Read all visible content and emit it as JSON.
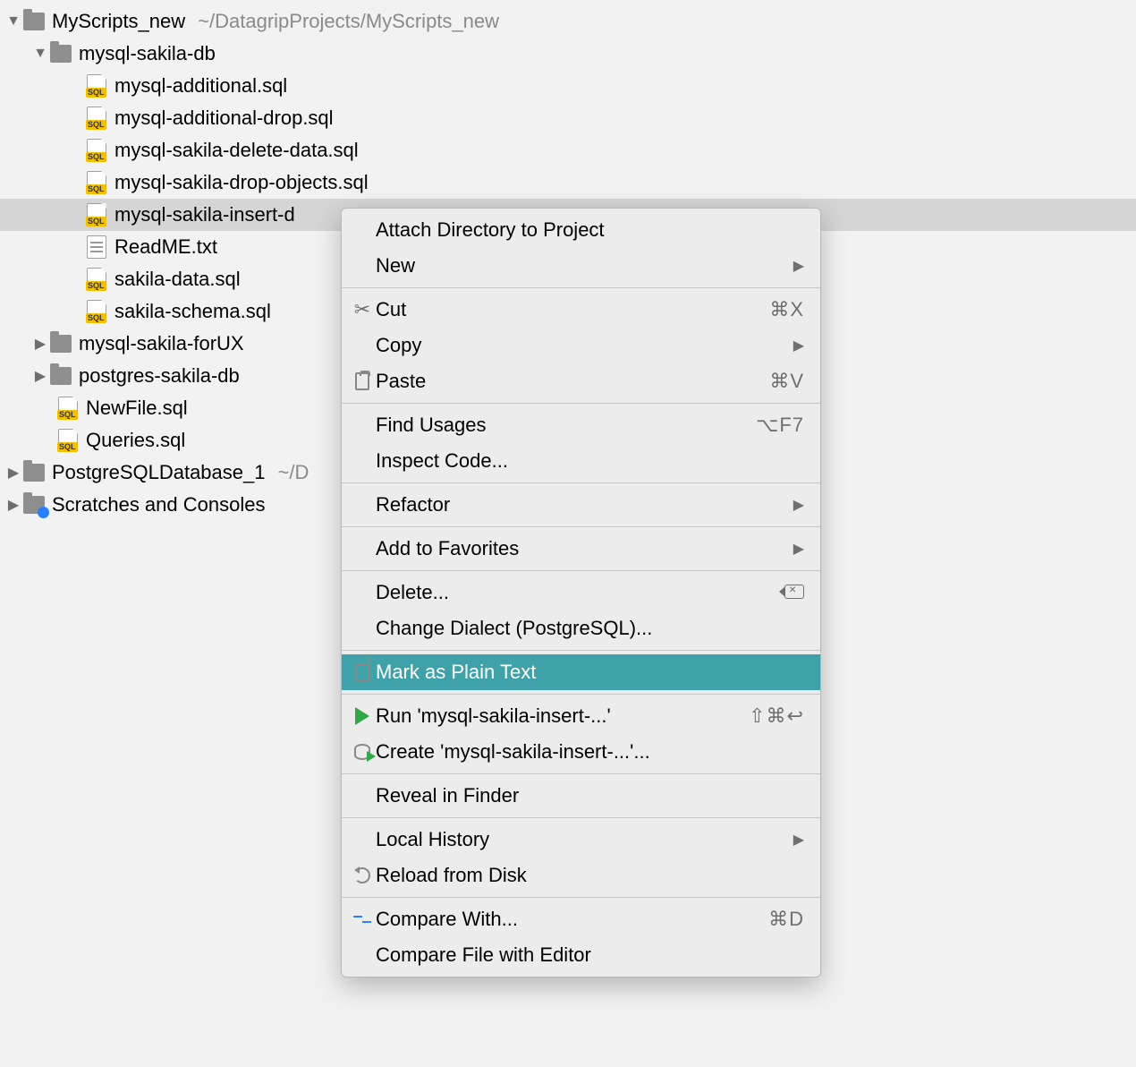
{
  "tree": {
    "root": {
      "name": "MyScripts_new",
      "path": "~/DatagripProjects/MyScripts_new"
    },
    "mysql_sakila_db": "mysql-sakila-db",
    "files": [
      "mysql-additional.sql",
      "mysql-additional-drop.sql",
      "mysql-sakila-delete-data.sql",
      "mysql-sakila-drop-objects.sql",
      "mysql-sakila-insert-d",
      "ReadME.txt",
      "sakila-data.sql",
      "sakila-schema.sql"
    ],
    "mysql_sakila_forux": "mysql-sakila-forUX",
    "postgres_sakila_db": "postgres-sakila-db",
    "newfile": "NewFile.sql",
    "queries": "Queries.sql",
    "pgdb": {
      "name": "PostgreSQLDatabase_1",
      "path": "~/D"
    },
    "scratches": "Scratches and Consoles"
  },
  "menu": {
    "attach": "Attach Directory to Project",
    "new": "New",
    "cut": "Cut",
    "cut_sc": "⌘X",
    "copy": "Copy",
    "paste": "Paste",
    "paste_sc": "⌘V",
    "find_usages": "Find Usages",
    "find_sc": "⌥F7",
    "inspect": "Inspect Code...",
    "refactor": "Refactor",
    "favorites": "Add to Favorites",
    "delete": "Delete...",
    "dialect": "Change Dialect (PostgreSQL)...",
    "mark": "Mark as Plain Text",
    "run": "Run 'mysql-sakila-insert-...'",
    "run_sc": "⇧⌘↩",
    "create": "Create 'mysql-sakila-insert-...'...",
    "reveal": "Reveal in Finder",
    "history": "Local History",
    "reload": "Reload from Disk",
    "compare": "Compare With...",
    "compare_sc": "⌘D",
    "compare_editor": "Compare File with Editor"
  }
}
